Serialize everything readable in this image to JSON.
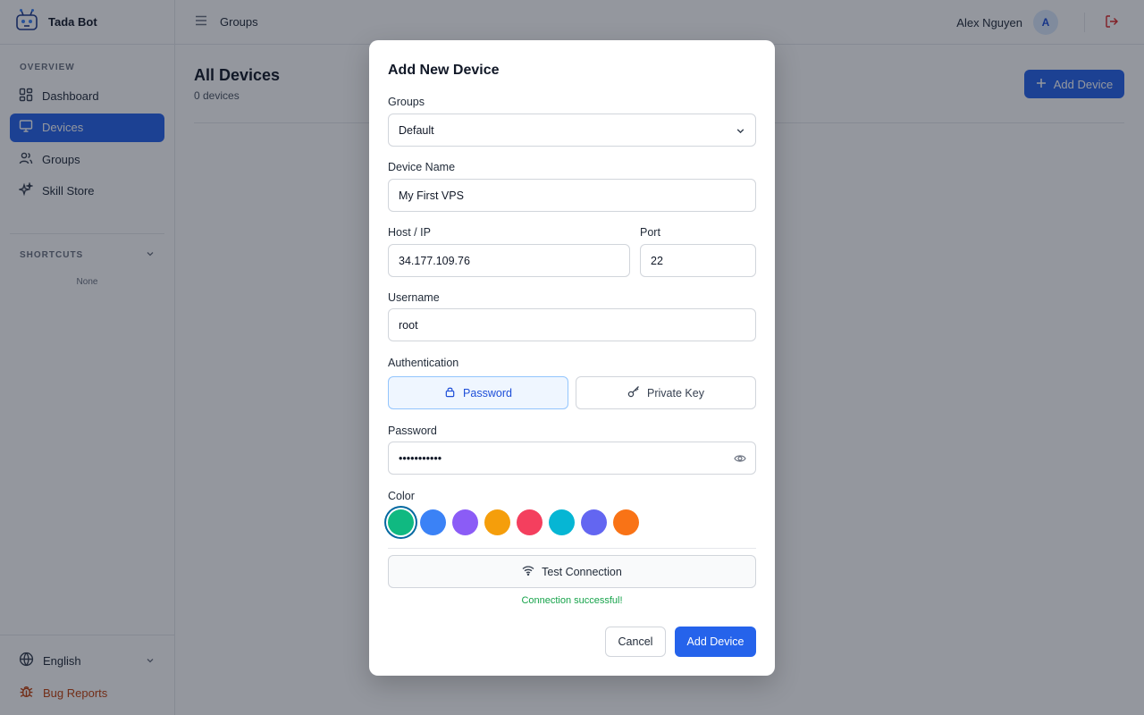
{
  "app": {
    "name": "Tada Bot"
  },
  "sidebar": {
    "overview_label": "OVERVIEW",
    "items": [
      {
        "label": "Dashboard",
        "icon": "grid-icon",
        "active": false
      },
      {
        "label": "Devices",
        "icon": "monitor-icon",
        "active": true
      },
      {
        "label": "Groups",
        "icon": "users-icon",
        "active": false
      },
      {
        "label": "Skill Store",
        "icon": "sparkles-icon",
        "active": false
      }
    ],
    "shortcuts_label": "SHORTCUTS",
    "shortcuts_empty": "None",
    "language": "English",
    "bug_reports": "Bug Reports"
  },
  "header": {
    "title": "Groups",
    "user_name": "Alex Nguyen",
    "avatar_initial": "A"
  },
  "main": {
    "title": "All Devices",
    "subtitle": "0 devices",
    "add_button": "Add Device"
  },
  "modal": {
    "title": "Add New Device",
    "groups_label": "Groups",
    "groups_value": "Default",
    "device_name_label": "Device Name",
    "device_name_value": "My First VPS",
    "host_label": "Host / IP",
    "host_value": "34.177.109.76",
    "port_label": "Port",
    "port_value": "22",
    "username_label": "Username",
    "username_value": "root",
    "auth_label": "Authentication",
    "auth_password": "Password",
    "auth_private_key": "Private Key",
    "password_label": "Password",
    "password_value": "•••••••••••",
    "color_label": "Color",
    "colors": [
      "#10b981",
      "#3b82f6",
      "#8b5cf6",
      "#f59e0b",
      "#f43f5e",
      "#06b6d4",
      "#6366f1",
      "#f97316"
    ],
    "selected_color": "#10b981",
    "test_button": "Test Connection",
    "test_status": "Connection successful!",
    "cancel_button": "Cancel",
    "submit_button": "Add Device"
  },
  "colors": {
    "accent": "#2563eb",
    "success": "#16a34a",
    "bug": "#c2410c"
  }
}
